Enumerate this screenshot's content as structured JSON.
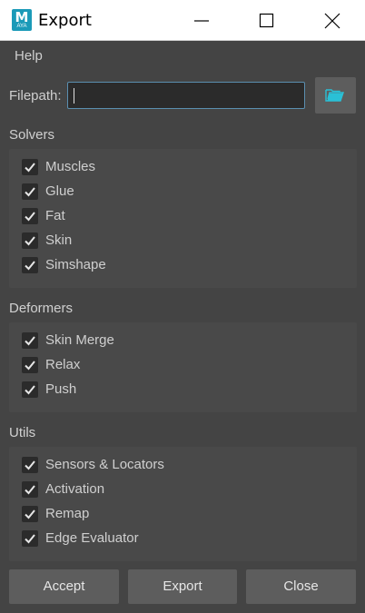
{
  "window": {
    "title": "Export",
    "app_icon_letter": "M",
    "app_icon_sub": "AYA",
    "minimize_icon": "minimize-icon",
    "maximize_icon": "maximize-icon",
    "close_icon": "close-icon"
  },
  "menu": {
    "help_label": "Help"
  },
  "filepath": {
    "label": "Filepath:",
    "value": "",
    "browse_icon": "folder-open-icon",
    "browse_color": "#2ac0d6"
  },
  "sections": {
    "solvers": {
      "title": "Solvers",
      "items": [
        {
          "label": "Muscles",
          "checked": true
        },
        {
          "label": "Glue",
          "checked": true
        },
        {
          "label": "Fat",
          "checked": true
        },
        {
          "label": "Skin",
          "checked": true
        },
        {
          "label": "Simshape",
          "checked": true
        }
      ]
    },
    "deformers": {
      "title": "Deformers",
      "items": [
        {
          "label": "Skin Merge",
          "checked": true
        },
        {
          "label": "Relax",
          "checked": true
        },
        {
          "label": "Push",
          "checked": true
        }
      ]
    },
    "utils": {
      "title": "Utils",
      "items": [
        {
          "label": "Sensors & Locators",
          "checked": true
        },
        {
          "label": "Activation",
          "checked": true
        },
        {
          "label": "Remap",
          "checked": true
        },
        {
          "label": "Edge Evaluator",
          "checked": true
        }
      ]
    }
  },
  "footer": {
    "accept_label": "Accept",
    "export_label": "Export",
    "close_label": "Close"
  }
}
